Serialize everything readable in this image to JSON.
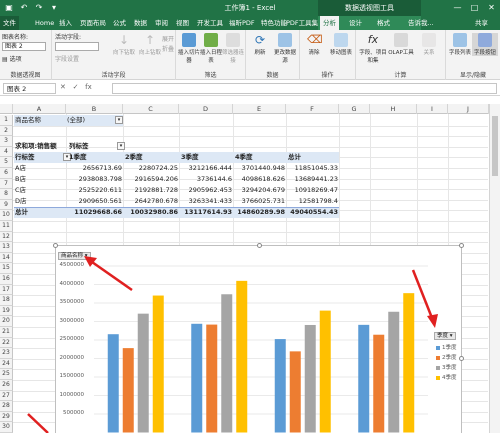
{
  "titlebar": {
    "doc_title": "工作簿1 - Excel",
    "context_title": "数据透视图工具",
    "win_buttons": [
      "—",
      "□",
      "✕"
    ]
  },
  "tabs": [
    "文件",
    "Home",
    "插入",
    "页面布局",
    "公式",
    "数据",
    "审阅",
    "视图",
    "开发工具",
    "福昕PDF",
    "特色功能",
    "PDF工具集",
    "分析",
    "设计",
    "格式",
    "告诉我...",
    "共享"
  ],
  "ribbon": {
    "chart_name_label": "图表名称:",
    "chart_name_value": "图表 2",
    "options_label": "选项",
    "active_field_label": "活动字段:",
    "field_settings": "字段设置",
    "group_data_pivot": "数据透视图",
    "group_active_field": "活动字段",
    "drill_down": "向下钻取",
    "drill_up": "向上钻取",
    "expand": "展开",
    "collapse": "折叠",
    "insert_slicer": "插入切片器",
    "insert_timeline": "插入日程表",
    "filter_connections": "筛选器连接",
    "group_filter": "筛选",
    "refresh": "刷新",
    "change_source": "更改数据源",
    "group_data": "数据",
    "clear": "清除",
    "move_chart": "移动图表",
    "group_actions": "操作",
    "fields_items": "字段、项目和集",
    "olap_tools": "OLAP工具",
    "relationships": "关系",
    "group_calc": "计算",
    "field_list": "字段列表",
    "field_buttons": "字段按钮",
    "group_show_hide": "显示/隐藏"
  },
  "formula_bar": {
    "name_box": "图表 2",
    "icons": [
      "✕",
      "✓",
      "fx"
    ]
  },
  "grid": {
    "columns": [
      "A",
      "B",
      "C",
      "D",
      "E",
      "F",
      "G",
      "H",
      "I",
      "J"
    ],
    "rows": [
      "1",
      "2",
      "3",
      "4",
      "5",
      "6",
      "7",
      "8",
      "9",
      "10",
      "11",
      "12",
      "13",
      "14",
      "15",
      "16",
      "17",
      "18",
      "19",
      "20",
      "21",
      "22",
      "23",
      "24",
      "25",
      "26",
      "27",
      "28",
      "29",
      "30"
    ],
    "filter_label": "商品名称",
    "filter_value": "(全部)",
    "sum_label": "求和项:销售额",
    "col_label": "列标签",
    "row_label": "行标签",
    "quarters": [
      "1季度",
      "2季度",
      "3季度",
      "4季度"
    ],
    "total_label": "总计",
    "stores": [
      {
        "name": "A店",
        "q1": "2656713.69",
        "q2": "2280724.25",
        "q3": "3212166.444",
        "q4": "3701440.948",
        "total": "11851045.33"
      },
      {
        "name": "B店",
        "q1": "2938083.798",
        "q2": "2916594.206",
        "q3": "3736144.6",
        "q4": "4098618.626",
        "total": "13689441.23"
      },
      {
        "name": "C店",
        "q1": "2525220.611",
        "q2": "2192881.728",
        "q3": "2905962.453",
        "q4": "3294204.679",
        "total": "10918269.47"
      },
      {
        "name": "D店",
        "q1": "2909650.561",
        "q2": "2642780.678",
        "q3": "3263341.433",
        "q4": "3766025.731",
        "total": "12581798.4"
      }
    ],
    "grand_total": {
      "name": "总计",
      "q1": "11029668.66",
      "q2": "10032980.86",
      "q3": "13117614.93",
      "q4": "14860289.98",
      "total": "49040554.43"
    }
  },
  "chart": {
    "field_button": "商品名称 ▾",
    "legend_field": "季度 ▾"
  },
  "chart_data": {
    "type": "bar",
    "categories": [
      "A店",
      "B店",
      "C店",
      "D店"
    ],
    "series": [
      {
        "name": "1季度",
        "values": [
          2656713.69,
          2938083.798,
          2525220.611,
          2909650.561
        ],
        "color": "#5b9bd5"
      },
      {
        "name": "2季度",
        "values": [
          2280724.25,
          2916594.206,
          2192881.728,
          2642780.678
        ],
        "color": "#ed7d31"
      },
      {
        "name": "3季度",
        "values": [
          3212166.444,
          3736144.6,
          2905962.453,
          3263341.433
        ],
        "color": "#a5a5a5"
      },
      {
        "name": "4季度",
        "values": [
          3701440.948,
          4098618.626,
          3294204.679,
          3766025.731
        ],
        "color": "#ffc000"
      }
    ],
    "yticks": [
      "4500000",
      "4000000",
      "3500000",
      "3000000",
      "2500000",
      "2000000",
      "1500000",
      "1000000",
      "500000"
    ],
    "ylim": [
      0,
      4500000
    ],
    "legend_position": "right"
  }
}
